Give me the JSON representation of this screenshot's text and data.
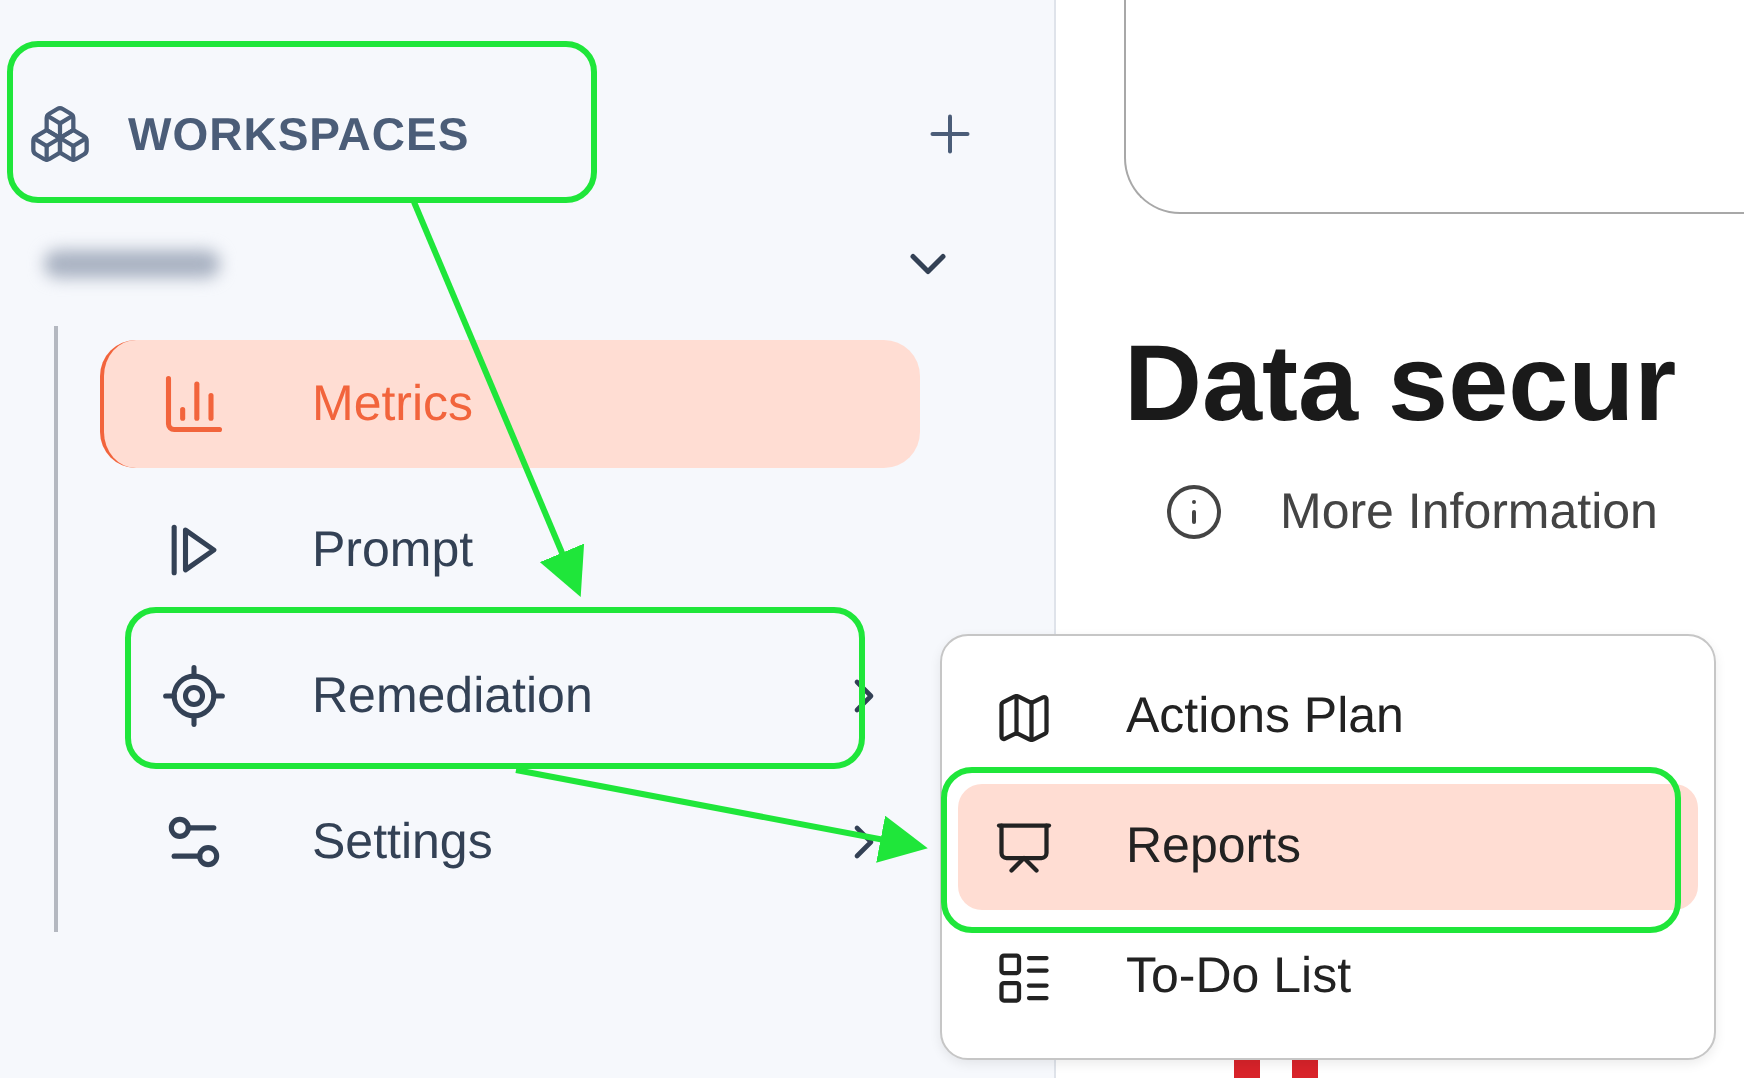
{
  "sidebar": {
    "header": {
      "title": "WORKSPACES"
    },
    "workspace": {
      "expanded": true
    },
    "items": [
      {
        "kind": "metrics",
        "label": "Metrics",
        "selected": true,
        "has_submenu": false
      },
      {
        "kind": "prompt",
        "label": "Prompt",
        "selected": false,
        "has_submenu": false
      },
      {
        "kind": "remediation",
        "label": "Remediation",
        "selected": false,
        "has_submenu": true
      },
      {
        "kind": "settings",
        "label": "Settings",
        "selected": false,
        "has_submenu": true
      }
    ]
  },
  "submenu": {
    "items": [
      {
        "kind": "map",
        "label": "Actions Plan",
        "selected": false
      },
      {
        "kind": "presentation",
        "label": "Reports",
        "selected": true
      },
      {
        "kind": "list",
        "label": "To-Do List",
        "selected": false
      }
    ]
  },
  "main": {
    "title": "Data secur",
    "info_link": "More Information"
  }
}
